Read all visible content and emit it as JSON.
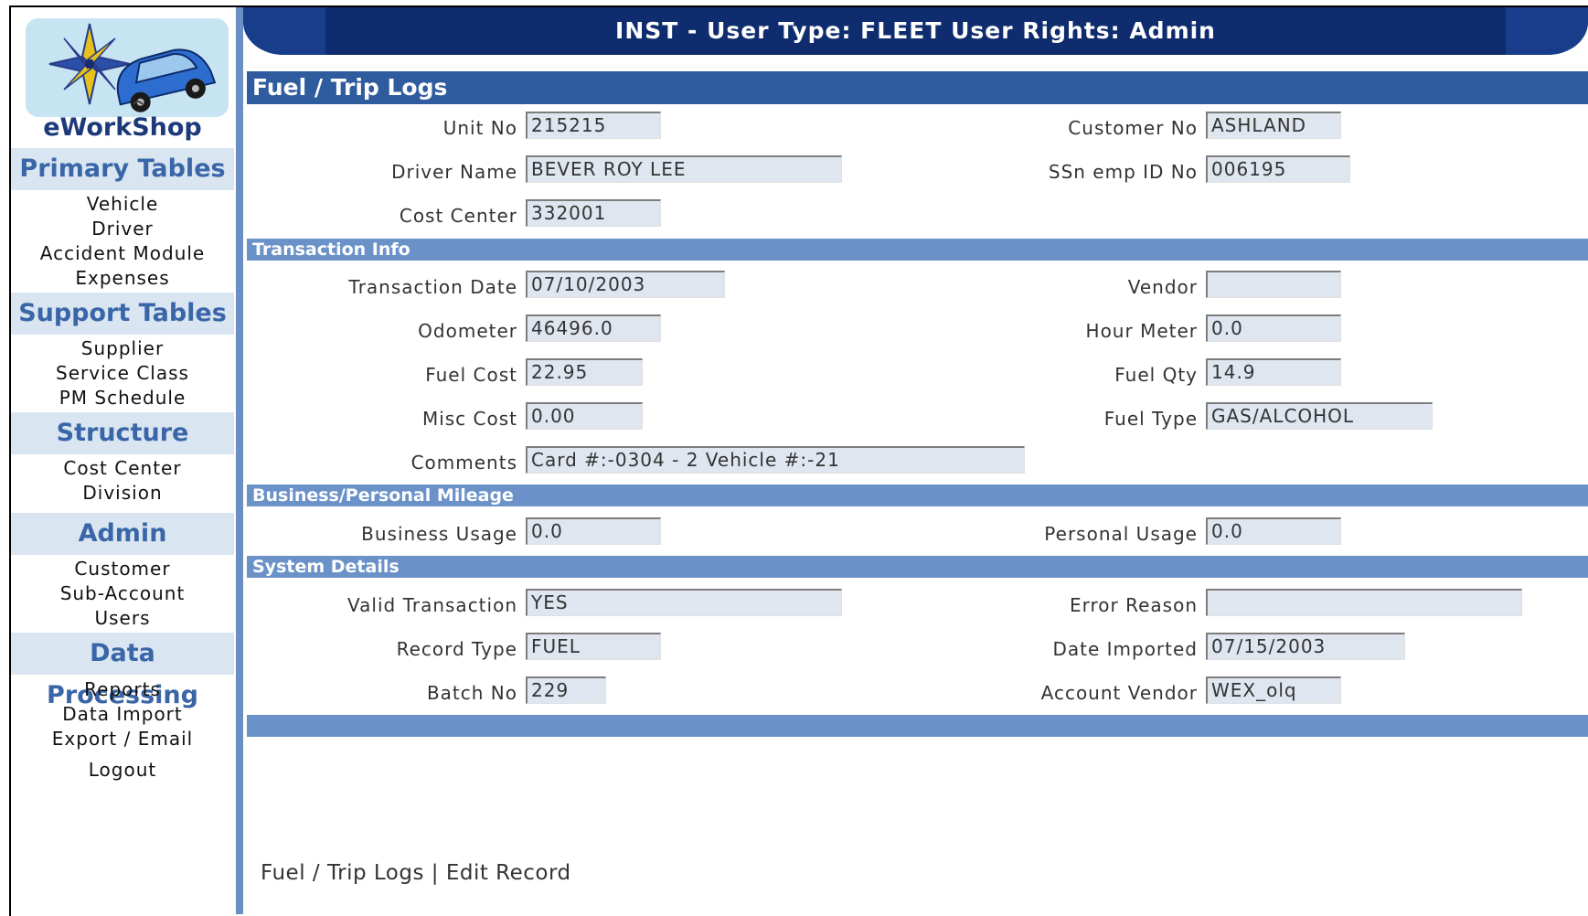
{
  "header": {
    "title": "INST - User Type: FLEET User Rights: Admin"
  },
  "sidebar": {
    "brand": "eWorkShop",
    "sections": [
      {
        "title": "Primary Tables",
        "items": [
          "Vehicle",
          "Driver",
          "Accident Module",
          "Expenses"
        ]
      },
      {
        "title": "Support Tables",
        "items": [
          "Supplier",
          "Service Class",
          "PM Schedule"
        ]
      },
      {
        "title": "Structure",
        "items": [
          "Cost Center",
          "Division"
        ]
      },
      {
        "title": "Admin",
        "items": [
          "Customer",
          "Sub-Account",
          "Users"
        ]
      },
      {
        "title": "Data Processing",
        "items": [
          "Reports",
          "Data Import",
          "Export / Email",
          "Logout"
        ]
      }
    ]
  },
  "page": {
    "title": "Fuel / Trip Logs",
    "unit_no": {
      "label": "Unit No",
      "value": "215215"
    },
    "customer_no": {
      "label": "Customer No",
      "value": "ASHLAND"
    },
    "driver_name": {
      "label": "Driver Name",
      "value": "BEVER ROY LEE"
    },
    "ssn": {
      "label": "SSn emp ID No",
      "value": "006195"
    },
    "cost_center": {
      "label": "Cost Center",
      "value": "332001"
    }
  },
  "transaction": {
    "title": "Transaction Info",
    "date": {
      "label": "Transaction Date",
      "value": "07/10/2003"
    },
    "vendor": {
      "label": "Vendor",
      "value": ""
    },
    "odometer": {
      "label": "Odometer",
      "value": "46496.0"
    },
    "hour_meter": {
      "label": "Hour Meter",
      "value": "0.0"
    },
    "fuel_cost": {
      "label": "Fuel Cost",
      "value": "22.95"
    },
    "fuel_qty": {
      "label": "Fuel Qty",
      "value": "14.9"
    },
    "misc_cost": {
      "label": "Misc Cost",
      "value": "0.00"
    },
    "fuel_type": {
      "label": "Fuel Type",
      "value": "GAS/ALCOHOL"
    },
    "comments": {
      "label": "Comments",
      "value": "Card #:-0304 - 2 Vehicle #:-21"
    }
  },
  "mileage": {
    "title": "Business/Personal Mileage",
    "business": {
      "label": "Business Usage",
      "value": "0.0"
    },
    "personal": {
      "label": "Personal Usage",
      "value": "0.0"
    }
  },
  "system": {
    "title": "System Details",
    "valid": {
      "label": "Valid Transaction",
      "value": "YES"
    },
    "error_reason": {
      "label": "Error Reason",
      "value": ""
    },
    "record_type": {
      "label": "Record Type",
      "value": "FUEL"
    },
    "date_imported": {
      "label": "Date Imported",
      "value": "07/15/2003"
    },
    "batch_no": {
      "label": "Batch No",
      "value": "229"
    },
    "account_vendor": {
      "label": "Account Vendor",
      "value": "WEX_olq"
    }
  },
  "footer": {
    "link1": "Fuel / Trip Logs",
    "separator": "|",
    "link2": "Edit Record"
  }
}
